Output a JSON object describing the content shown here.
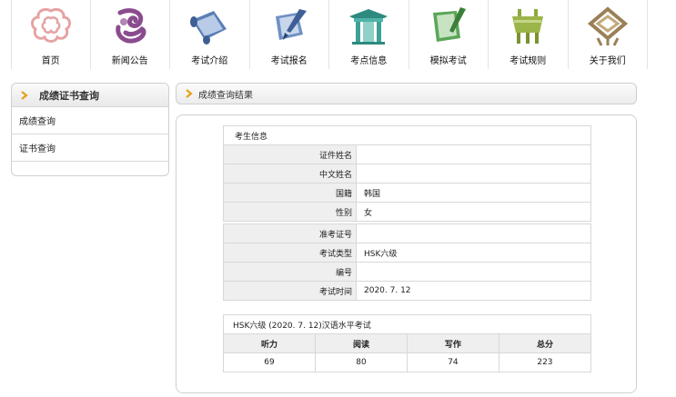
{
  "nav": {
    "items": [
      {
        "label": "首页",
        "icon": "ruyi-cloud-icon",
        "color": "#e8a8a8"
      },
      {
        "label": "新闻公告",
        "icon": "swirl-dragon-icon",
        "color": "#8a4c8e"
      },
      {
        "label": "考试介绍",
        "icon": "scroll-icon",
        "color": "#4a6fa8"
      },
      {
        "label": "考试报名",
        "icon": "brush-scroll-icon",
        "color": "#4a6fa8"
      },
      {
        "label": "考点信息",
        "icon": "pavilion-icon",
        "color": "#3ea196"
      },
      {
        "label": "模拟考试",
        "icon": "bamboo-scroll-icon",
        "color": "#4e9a4b"
      },
      {
        "label": "考试规则",
        "icon": "bronze-ding-icon",
        "color": "#8fa83e"
      },
      {
        "label": "关于我们",
        "icon": "knot-icon",
        "color": "#9a8056"
      }
    ]
  },
  "sidebar": {
    "title": "成绩证书查询",
    "items": [
      {
        "label": "成绩查询"
      },
      {
        "label": "证书查询"
      }
    ]
  },
  "result": {
    "title": "成绩查询结果"
  },
  "candidate": {
    "caption": "考生信息",
    "rows1": [
      {
        "label": "证件姓名",
        "value": ""
      },
      {
        "label": "中文姓名",
        "value": ""
      },
      {
        "label": "国籍",
        "value": "韩国"
      },
      {
        "label": "性别",
        "value": "女"
      }
    ],
    "rows2": [
      {
        "label": "准考证号",
        "value": ""
      },
      {
        "label": "考试类型",
        "value": "HSK六级"
      },
      {
        "label": "编号",
        "value": ""
      },
      {
        "label": "考试时间",
        "value": "2020. 7. 12"
      }
    ]
  },
  "scores": {
    "caption": "HSK六级 (2020. 7. 12)汉语水平考试",
    "headers": [
      "听力",
      "阅读",
      "写作",
      "总分"
    ],
    "values": [
      "69",
      "80",
      "74",
      "223"
    ]
  },
  "colors": {
    "accent_chevron": "#e3a21a"
  }
}
